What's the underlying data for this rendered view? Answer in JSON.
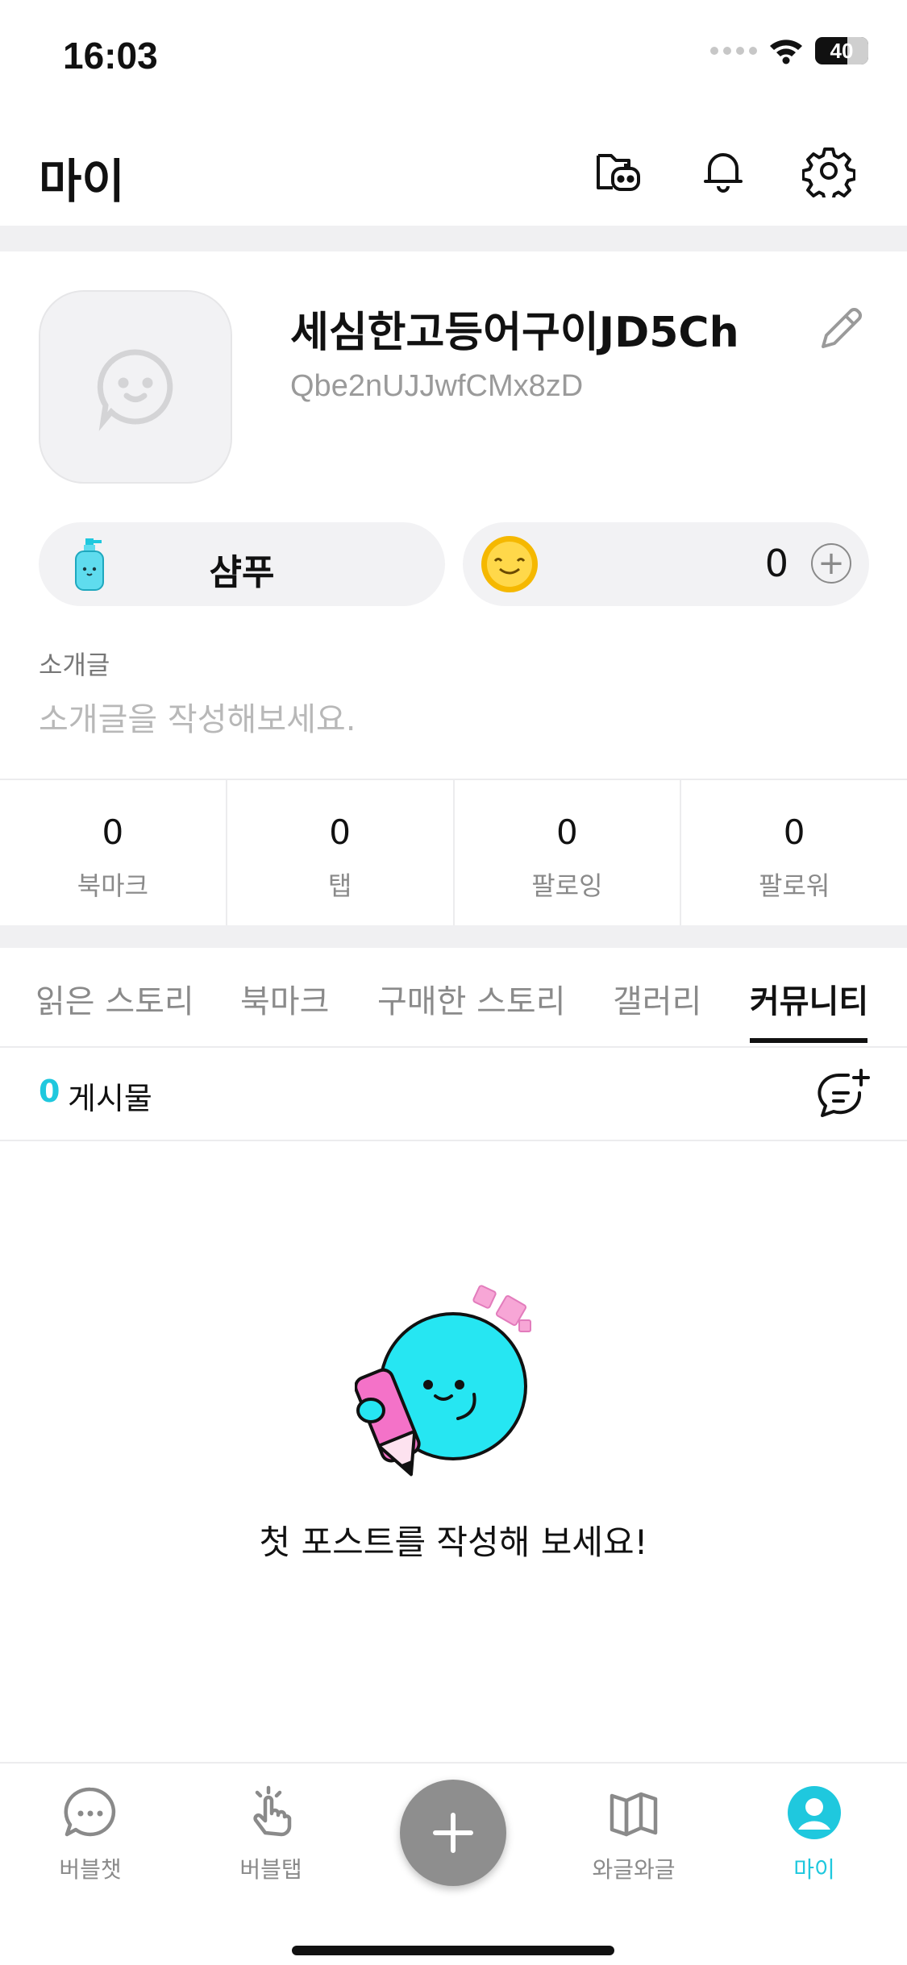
{
  "status_bar": {
    "time": "16:03",
    "battery": "40"
  },
  "header": {
    "title": "마이"
  },
  "profile": {
    "nickname": "세심한고등어구이JD5Ch",
    "user_id": "Qbe2nUJJwfCMx8zD",
    "shampoo_label": "샴푸",
    "coin_count": "0"
  },
  "intro": {
    "label": "소개글",
    "placeholder": "소개글을 작성해보세요."
  },
  "stats": [
    {
      "value": "0",
      "label": "북마크"
    },
    {
      "value": "0",
      "label": "탭"
    },
    {
      "value": "0",
      "label": "팔로잉"
    },
    {
      "value": "0",
      "label": "팔로워"
    }
  ],
  "tabs": [
    {
      "label": "읽은 스토리"
    },
    {
      "label": "북마크"
    },
    {
      "label": "구매한 스토리"
    },
    {
      "label": "갤러리"
    },
    {
      "label": "커뮤니티",
      "active": true
    }
  ],
  "posts": {
    "count": "0",
    "label": "게시물"
  },
  "empty_state": {
    "message": "첫 포스트를 작성해 보세요!"
  },
  "bottom_nav": [
    {
      "label": "버블챗",
      "icon": "chat-bubble-icon"
    },
    {
      "label": "버블탭",
      "icon": "tap-hand-icon"
    },
    {
      "label": "와글와글",
      "icon": "open-book-icon"
    },
    {
      "label": "마이",
      "icon": "profile-icon",
      "active": true
    }
  ],
  "colors": {
    "accent": "#1fc8de",
    "inactive": "#8a8a8a",
    "band": "#f0f0f2",
    "fab": "#8e8e8e"
  }
}
